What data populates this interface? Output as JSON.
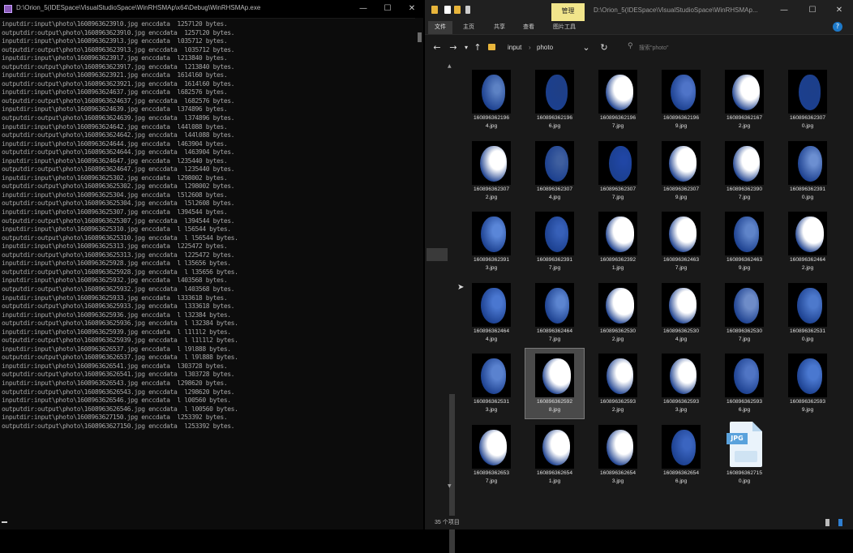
{
  "console": {
    "title": "D:\\Orion_5(IDESpace\\VisualStudioSpace\\WinRHSMAp\\x64\\Debug\\WinRHSMAp.exe",
    "controls": {
      "minimize": "—",
      "maximize": "☐",
      "close": "✕"
    },
    "lines": [
      "inputdir:input\\photo\\16089636239l0.jpg enccdata  1257l20 bytes.",
      "outputdir:output\\photo\\16089636239l0.jpg enccdata  1257l20 bytes.",
      "inputdir:input\\photo\\16089636239l3.jpg enccdata  l035712 bytes.",
      "outputdir:output\\photo\\16089636239l3.jpg enccdata  l035712 bytes.",
      "inputdir:input\\photo\\16089636239l7.jpg enccdata  l213840 bytes.",
      "outputdir:output\\photo\\16089636239l7.jpg enccdata  l213840 bytes.",
      "inputdir:input\\photo\\1608963623921.jpg enccdata  1614l60 bytes.",
      "outputdir:output\\photo\\1608963623921.jpg enccdata  1614l60 bytes.",
      "inputdir:input\\photo\\1608963624637.jpg enccdata  l682576 bytes.",
      "outputdir:output\\photo\\1608963624637.jpg enccdata  l682576 bytes.",
      "inputdir:input\\photo\\1608963624639.jpg enccdata  l374896 bytes.",
      "outputdir:output\\photo\\1608963624639.jpg enccdata  l374896 bytes.",
      "inputdir:input\\photo\\1608963624642.jpg enccdata  l44l088 bytes.",
      "outputdir:output\\photo\\1608963624642.jpg enccdata  l44l088 bytes.",
      "inputdir:input\\photo\\1608963624644.jpg enccdata  l463904 bytes.",
      "outputdir:output\\photo\\1608963624644.jpg enccdata  l463904 bytes.",
      "inputdir:input\\photo\\1608963624647.jpg enccdata  l235440 bytes.",
      "outputdir:output\\photo\\1608963624647.jpg enccdata  l235440 bytes.",
      "inputdir:input\\photo\\1608963625302.jpg enccdata  l298002 bytes.",
      "outputdir:output\\photo\\1608963625302.jpg enccdata  l298002 bytes.",
      "inputdir:input\\photo\\1608963625304.jpg enccdata  l5l2608 bytes.",
      "outputdir:output\\photo\\1608963625304.jpg enccdata  l5l2608 bytes.",
      "inputdir:input\\photo\\1608963625307.jpg enccdata  l394544 bytes.",
      "outputdir:output\\photo\\1608963625307.jpg enccdata  l394544 bytes.",
      "inputdir:input\\photo\\1608963625310.jpg enccdata  l l56544 bytes.",
      "outputdir:output\\photo\\1608963625310.jpg enccdata  l l56544 bytes.",
      "inputdir:input\\photo\\1608963625313.jpg enccdata  l225472 bytes.",
      "outputdir:output\\photo\\1608963625313.jpg enccdata  l225472 bytes.",
      "inputdir:input\\photo\\1608963625928.jpg enccdata  l l35656 bytes.",
      "outputdir:output\\photo\\1608963625928.jpg enccdata  l l35656 bytes.",
      "inputdir:input\\photo\\1608963625932.jpg enccdata  l403568 bytes.",
      "outputdir:output\\photo\\1608963625932.jpg enccdata  l403568 bytes.",
      "inputdir:input\\photo\\1608963625933.jpg enccdata  l333618 bytes.",
      "outputdir:output\\photo\\1608963625933.jpg enccdata  l333618 bytes.",
      "inputdir:input\\photo\\1608963625936.jpg enccdata  l l32384 bytes.",
      "outputdir:output\\photo\\1608963625936.jpg enccdata  l l32384 bytes.",
      "inputdir:input\\photo\\1608963625939.jpg enccdata  l l1l1l2 bytes.",
      "outputdir:output\\photo\\1608963625939.jpg enccdata  l l1l1l2 bytes.",
      "inputdir:input\\photo\\1608963626537.jpg enccdata  l l9l888 bytes.",
      "outputdir:output\\photo\\1608963626537.jpg enccdata  l l9l888 bytes.",
      "inputdir:input\\photo\\1608963626541.jpg enccdata  l303728 bytes.",
      "outputdir:output\\photo\\1608963626541.jpg enccdata  l303728 bytes.",
      "inputdir:input\\photo\\1608963626543.jpg enccdata  l298620 bytes.",
      "outputdir:output\\photo\\1608963626543.jpg enccdata  l298620 bytes.",
      "inputdir:input\\photo\\1608963626546.jpg enccdata  l l00560 bytes.",
      "outputdir:output\\photo\\1608963626546.jpg enccdata  l l00560 bytes.",
      "inputdir:input\\photo\\1608963627150.jpg enccdata  l253392 bytes.",
      "outputdir:output\\photo\\1608963627150.jpg enccdata  l253392 bytes."
    ]
  },
  "explorer": {
    "manage_tab": "管理",
    "title": "D:\\Orion_5(IDESpace\\VisualStudioSpace\\WinRHSMAp...",
    "controls": {
      "minimize": "—",
      "maximize": "☐",
      "close": "✕"
    },
    "ribbon_tabs": [
      "文件",
      "主页",
      "共享",
      "查看",
      "图片工具"
    ],
    "help": "?",
    "nav": {
      "back": "←",
      "forward": "→",
      "recent": "▾",
      "up": "↑",
      "refresh": "↻",
      "dropdown": "⌄"
    },
    "breadcrumb": [
      "input",
      "›",
      "photo"
    ],
    "search_placeholder": "搜索\"photo\"",
    "tiles": [
      {
        "name": "160896362196\n4.jpg",
        "tone": "#5d82c4",
        "bright": 0.3
      },
      {
        "name": "160896362196\n6.jpg",
        "tone": "#1f3f86",
        "bright": 0.1
      },
      {
        "name": "160896362196\n7.jpg",
        "tone": "#ffffff",
        "bright": 0.85
      },
      {
        "name": "160896362196\n9.jpg",
        "tone": "#4f74c8",
        "bright": 0.45
      },
      {
        "name": "160896362167\n2.jpg",
        "tone": "#ffffff",
        "bright": 0.8
      },
      {
        "name": "160896362307\n0.jpg",
        "tone": "#1d3f8a",
        "bright": 0.1
      },
      {
        "name": "160896362307\n2.jpg",
        "tone": "#ffffff",
        "bright": 0.7
      },
      {
        "name": "160896362307\n4.jpg",
        "tone": "#3f5f9f",
        "bright": 0.3
      },
      {
        "name": "160896362307\n7.jpg",
        "tone": "#2046a5",
        "bright": 0.25
      },
      {
        "name": "160896362307\n9.jpg",
        "tone": "#ffffff",
        "bright": 0.85
      },
      {
        "name": "160896362390\n7.jpg",
        "tone": "#ffffff",
        "bright": 0.75
      },
      {
        "name": "160896362391\n0.jpg",
        "tone": "#6c8fd1",
        "bright": 0.4
      },
      {
        "name": "160896362391\n3.jpg",
        "tone": "#5a86d8",
        "bright": 0.45
      },
      {
        "name": "160896362391\n7.jpg",
        "tone": "#3760b8",
        "bright": 0.35
      },
      {
        "name": "160896362392\n1.jpg",
        "tone": "#ffffff",
        "bright": 0.9
      },
      {
        "name": "160896362463\n7.jpg",
        "tone": "#ffffff",
        "bright": 0.85
      },
      {
        "name": "160896362463\n9.jpg",
        "tone": "#5f84c9",
        "bright": 0.45
      },
      {
        "name": "160896362464\n2.jpg",
        "tone": "#ffffff",
        "bright": 0.9
      },
      {
        "name": "160896362464\n4.jpg",
        "tone": "#4a77d0",
        "bright": 0.45
      },
      {
        "name": "160896362464\n7.jpg",
        "tone": "#5c85d0",
        "bright": 0.4
      },
      {
        "name": "160896362530\n2.jpg",
        "tone": "#ffffff",
        "bright": 0.9
      },
      {
        "name": "160896362530\n4.jpg",
        "tone": "#ffffff",
        "bright": 0.8
      },
      {
        "name": "160896362530\n7.jpg",
        "tone": "#6e8cc8",
        "bright": 0.5
      },
      {
        "name": "160896362531\n0.jpg",
        "tone": "#4d79cc",
        "bright": 0.45
      },
      {
        "name": "160896362531\n3.jpg",
        "tone": "#5a82cf",
        "bright": 0.5
      },
      {
        "name": "160896362592\n8.jpg",
        "tone": "#ffffff",
        "bright": 0.9,
        "selected": true
      },
      {
        "name": "160896362593\n2.jpg",
        "tone": "#ffffff",
        "bright": 0.7
      },
      {
        "name": "160896362593\n3.jpg",
        "tone": "#ffffff",
        "bright": 0.75
      },
      {
        "name": "160896362593\n6.jpg",
        "tone": "#5075c4",
        "bright": 0.45
      },
      {
        "name": "160896362593\n9.jpg",
        "tone": "#4a78d0",
        "bright": 0.5
      },
      {
        "name": "160896362653\n7.jpg",
        "tone": "#ffffff",
        "bright": 0.85
      },
      {
        "name": "160896362654\n1.jpg",
        "tone": "#ffffff",
        "bright": 0.8
      },
      {
        "name": "160896362654\n3.jpg",
        "tone": "#ffffff",
        "bright": 0.75
      },
      {
        "name": "160896362654\n6.jpg",
        "tone": "#3b65c0",
        "bright": 0.4
      },
      {
        "name": "160896362715\n0.jpg",
        "type": "jpg-icon"
      }
    ],
    "jpg_badge": "JPG",
    "status": "35 个项目",
    "colors": {
      "manage_tab": "#f1e58b",
      "help": "#1d79c9",
      "selection": "#4a4a4a",
      "folder": "#e8b53b"
    }
  }
}
